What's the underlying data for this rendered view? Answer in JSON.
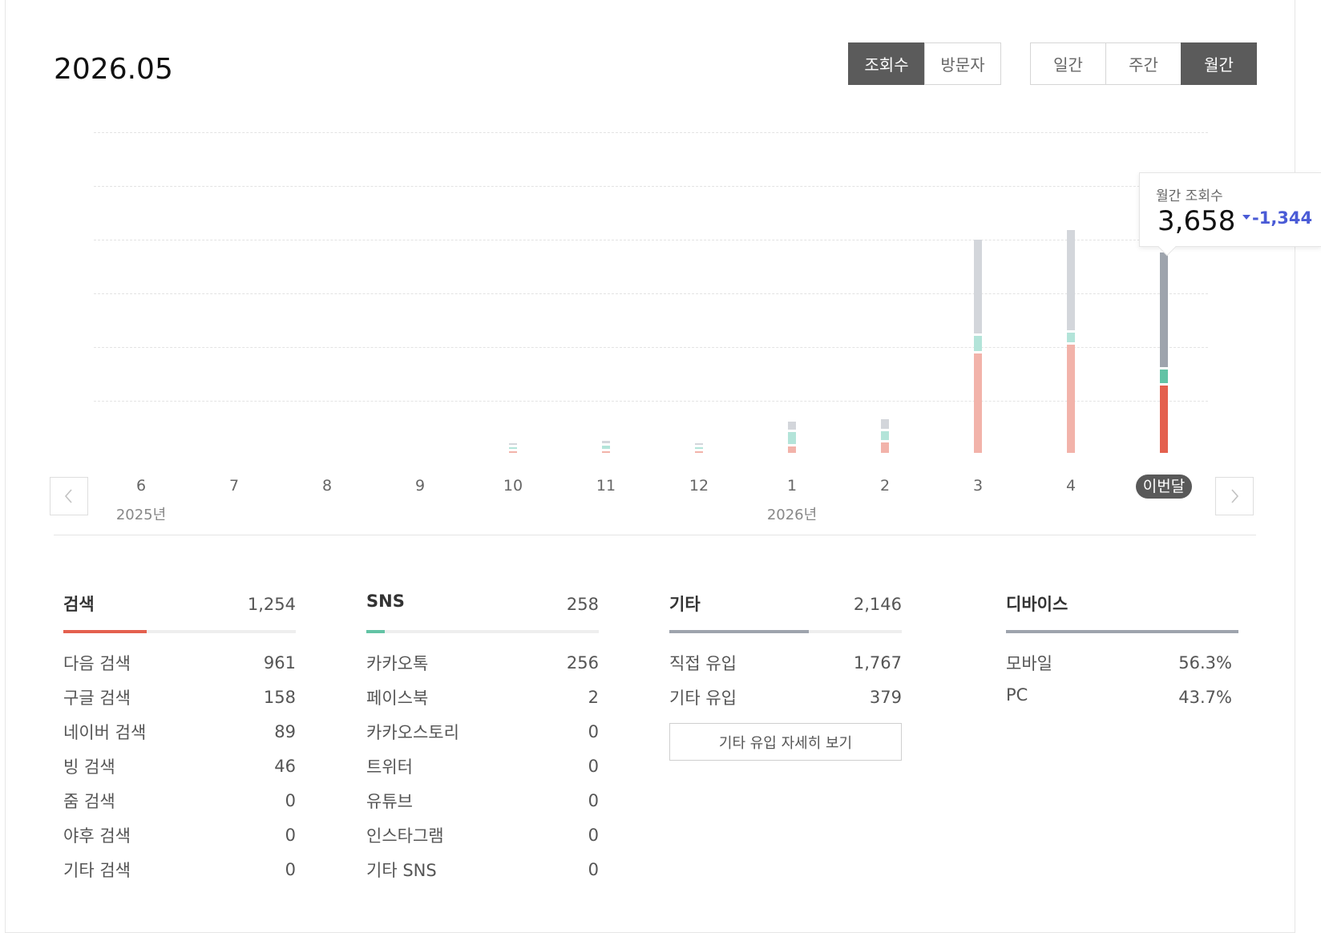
{
  "header": {
    "period": "2026.05"
  },
  "metric_toggle": {
    "items": [
      "조회수",
      "방문자"
    ],
    "active": 0
  },
  "interval_toggle": {
    "items": [
      "일간",
      "주간",
      "월간"
    ],
    "active": 2
  },
  "chart_data": {
    "type": "bar",
    "stacked": true,
    "categories": [
      "6",
      "7",
      "8",
      "9",
      "10",
      "11",
      "12",
      "1",
      "2",
      "3",
      "4",
      "이번달"
    ],
    "year_labels": [
      {
        "label": "2025년",
        "category": "6"
      },
      {
        "label": "2026년",
        "category": "1"
      }
    ],
    "series": [
      {
        "values": [
          0,
          0,
          0,
          0,
          10,
          50,
          15,
          150,
          180,
          1750,
          1870,
          2146
        ],
        "color": "#d3d6db"
      },
      {
        "values": [
          0,
          0,
          0,
          0,
          20,
          60,
          20,
          230,
          160,
          290,
          190,
          258
        ],
        "color": "#b3e4d9"
      },
      {
        "values": [
          0,
          0,
          0,
          0,
          30,
          30,
          10,
          120,
          200,
          1860,
          2020,
          1254
        ],
        "color": "#f2b3aa"
      }
    ],
    "highlight_index": 11,
    "ylim": [
      0,
      6000
    ],
    "grid": true,
    "tooltip": {
      "label": "월간 조회수",
      "value": "3,658",
      "delta": "-1,344"
    }
  },
  "nav": {
    "prev": "prev-arrow",
    "next": "next-arrow"
  },
  "sections": [
    {
      "title": "검색",
      "total": "1,254",
      "fill_ratio": 0.36,
      "color": "#e4604e",
      "rows": [
        [
          "다음 검색",
          "961"
        ],
        [
          "구글 검색",
          "158"
        ],
        [
          "네이버 검색",
          "89"
        ],
        [
          "빙 검색",
          "46"
        ],
        [
          "줌 검색",
          "0"
        ],
        [
          "야후 검색",
          "0"
        ],
        [
          "기타 검색",
          "0"
        ]
      ]
    },
    {
      "title": "SNS",
      "total": "258",
      "fill_ratio": 0.08,
      "color": "#62c3a5",
      "rows": [
        [
          "카카오톡",
          "256"
        ],
        [
          "페이스북",
          "2"
        ],
        [
          "카카오스토리",
          "0"
        ],
        [
          "트위터",
          "0"
        ],
        [
          "유튜브",
          "0"
        ],
        [
          "인스타그램",
          "0"
        ],
        [
          "기타 SNS",
          "0"
        ]
      ]
    },
    {
      "title": "기타",
      "total": "2,146",
      "fill_ratio": 0.6,
      "color": "#9ea4ad",
      "rows": [
        [
          "직접 유입",
          "1,767"
        ],
        [
          "기타 유입",
          "379"
        ]
      ],
      "more_button": "기타 유입 자세히 보기"
    },
    {
      "title": "디바이스",
      "total": "",
      "fill_ratio": 1.0,
      "color": "#9ea4ad",
      "rows": [
        [
          "모바일",
          "56.3%"
        ],
        [
          "PC",
          "43.7%"
        ]
      ]
    }
  ]
}
